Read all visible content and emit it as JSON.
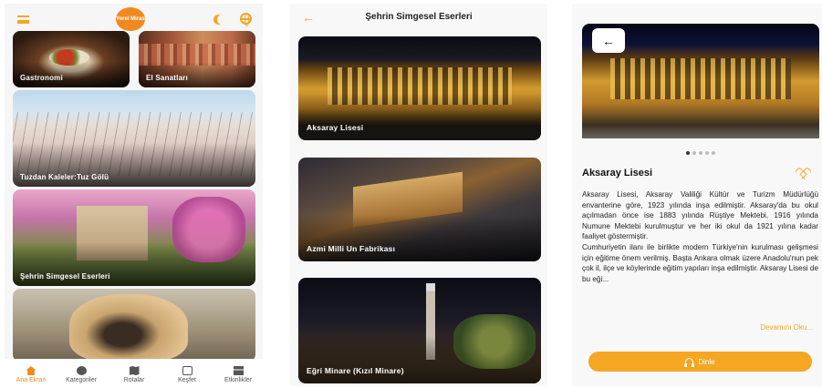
{
  "home": {
    "tiles": [
      {
        "label": "Gastronomi"
      },
      {
        "label": "El Sanatları"
      },
      {
        "label": "Tuzdan Kaleler:Tuz Gölü"
      },
      {
        "label": "Şehrin Simgesel Eserleri"
      },
      {
        "label": ""
      }
    ],
    "nav": [
      {
        "label": "Ana Ekran",
        "icon": "home-icon",
        "active": true
      },
      {
        "label": "Kategoriler",
        "icon": "compass-icon"
      },
      {
        "label": "Rotalar",
        "icon": "map-icon"
      },
      {
        "label": "Keşfet",
        "icon": "calendar-icon"
      },
      {
        "label": "Etkinlikler",
        "icon": "bank-icon"
      }
    ],
    "logo_text": "Yerel Miras"
  },
  "list": {
    "title": "Şehrin Simgesel Eserleri",
    "items": [
      {
        "label": "Aksaray Lisesi"
      },
      {
        "label": "Azmi Milli Un Fabrikası"
      },
      {
        "label": "Eğri Minare (Kızıl Minare)"
      }
    ]
  },
  "detail": {
    "title": "Aksaray Lisesi",
    "description": "Aksaray Lisesi, Aksaray Valiliği Kültür ve Turizm Müdürlüğü envanterine göre, 1923 yılında inşa edilmiştir. Aksaray'da bu okul açılmadan önce ise 1883 yılında Rüştiye Mektebi, 1916 yılında Numune Mektebi kurulmuştur ve her iki okul da 1921 yılına kadar faaliyet göstermiştir.\nCumhuriyetin ilanı ile birlikte modern Türkiye'nin kurulması gelişmesi için eğitime önem verilmiş. Başta Ankara olmak üzere Anadolu'nun pek çok il, ilçe ve köylerinde eğitim yapıları inşa edilmiştir. Aksaray Lisesi de bu eği...",
    "read_more": "Devamını Oku...",
    "listen": "Dinle",
    "image_count": 5,
    "active_image": 1
  },
  "colors": {
    "accent": "#f5a623"
  }
}
